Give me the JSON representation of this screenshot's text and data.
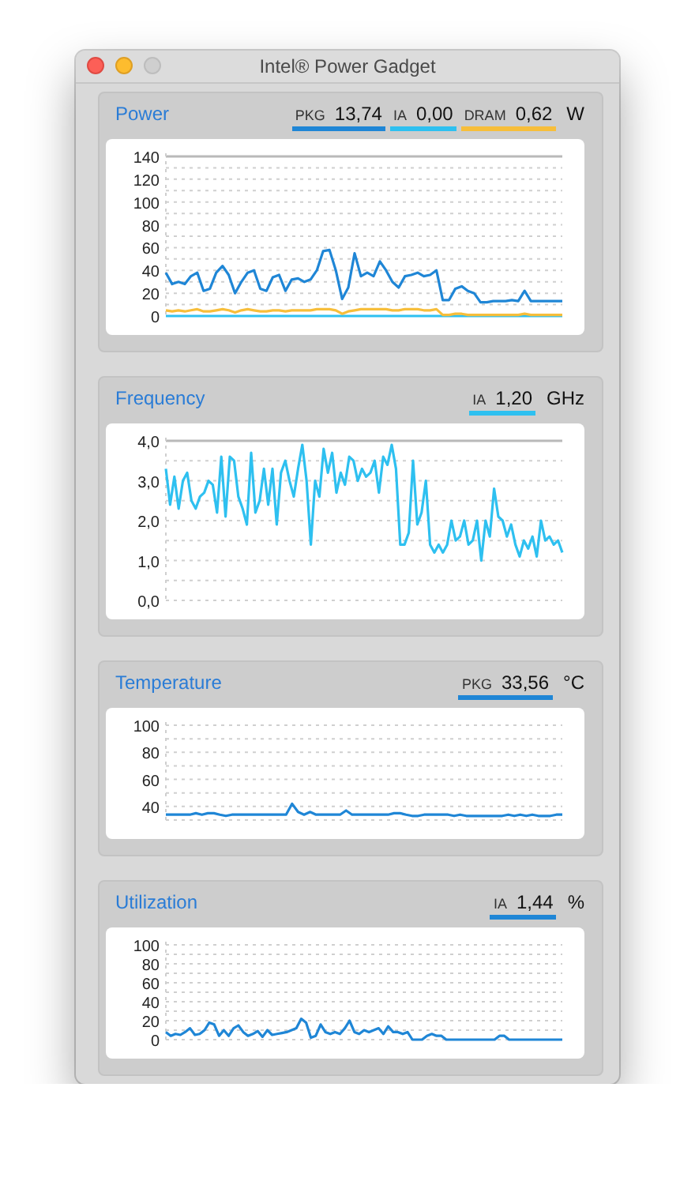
{
  "window": {
    "title": "Intel® Power Gadget"
  },
  "panels": [
    {
      "title": "Power",
      "readouts": [
        {
          "value": "13,74"
        },
        {
          "value": "0,00"
        },
        {
          "value": "0,62"
        }
      ],
      "unit": "W",
      "chart_data": {
        "type": "line",
        "grid": true,
        "ylim": [
          0,
          140
        ],
        "yticks": [
          0,
          20,
          40,
          60,
          80,
          100,
          120,
          140
        ],
        "series": [
          {
            "name": "PKG",
            "color": "#1f86d6",
            "values": [
              38,
              28,
              30,
              28,
              35,
              38,
              22,
              24,
              38,
              44,
              36,
              20,
              30,
              38,
              40,
              24,
              22,
              34,
              36,
              22,
              32,
              33,
              30,
              32,
              40,
              57,
              58,
              40,
              15,
              25,
              55,
              35,
              38,
              35,
              48,
              40,
              30,
              25,
              35,
              36,
              38,
              35,
              36,
              40,
              14,
              14,
              24,
              26,
              22,
              20,
              12,
              12,
              13,
              13,
              13,
              14,
              13,
              22,
              13,
              13,
              13,
              13,
              13,
              13
            ]
          },
          {
            "name": "IA",
            "color": "#2ec0f0",
            "values": [
              0,
              0,
              0,
              0,
              0,
              0,
              0,
              0,
              0,
              0,
              0,
              0,
              0,
              0,
              0,
              0,
              0,
              0,
              0,
              0,
              0,
              0,
              0,
              0,
              0,
              0,
              0,
              0,
              0,
              0,
              0,
              0,
              0,
              0,
              0,
              0,
              0,
              0,
              0,
              0,
              0,
              0,
              0,
              0,
              0,
              0,
              0,
              0,
              0,
              0,
              0,
              0,
              0,
              0,
              0,
              0,
              0,
              0,
              0,
              0,
              0,
              0,
              0,
              0
            ]
          },
          {
            "name": "DRAM",
            "color": "#f7be3a",
            "values": [
              5,
              4,
              5,
              4,
              5,
              6,
              4,
              4,
              5,
              6,
              5,
              3,
              5,
              6,
              5,
              4,
              4,
              5,
              5,
              4,
              5,
              5,
              5,
              5,
              6,
              6,
              6,
              5,
              2,
              4,
              5,
              6,
              6,
              6,
              6,
              6,
              5,
              5,
              6,
              6,
              6,
              5,
              5,
              6,
              1,
              1,
              2,
              2,
              1,
              1,
              1,
              1,
              1,
              1,
              1,
              1,
              1,
              2,
              1,
              1,
              1,
              1,
              1,
              1
            ]
          }
        ]
      }
    },
    {
      "title": "Frequency",
      "readouts": [
        {
          "value": "1,20"
        }
      ],
      "unit": "GHz",
      "chart_data": {
        "type": "line",
        "grid": true,
        "ylim": [
          0,
          4
        ],
        "yticks": [
          {
            "value": 0,
            "label": "0,0"
          },
          {
            "value": 1,
            "label": "1,0"
          },
          {
            "value": 2,
            "label": "2,0"
          },
          {
            "value": 3,
            "label": "3,0"
          },
          {
            "value": 4,
            "label": "4,0"
          }
        ],
        "series": [
          {
            "name": "IA",
            "color": "#2ec0f0",
            "values": [
              3.3,
              2.4,
              3.1,
              2.3,
              3.0,
              3.2,
              2.5,
              2.3,
              2.6,
              2.7,
              3.0,
              2.9,
              2.2,
              3.6,
              2.1,
              3.6,
              3.5,
              2.6,
              2.3,
              1.9,
              3.7,
              2.2,
              2.5,
              3.3,
              2.4,
              3.3,
              1.9,
              3.2,
              3.5,
              3.0,
              2.6,
              3.3,
              3.9,
              3.0,
              1.4,
              3.0,
              2.6,
              3.8,
              3.2,
              3.7,
              2.7,
              3.2,
              2.9,
              3.6,
              3.5,
              3.0,
              3.3,
              3.1,
              3.2,
              3.5,
              2.7,
              3.6,
              3.4,
              3.9,
              3.3,
              1.4,
              1.4,
              1.7,
              3.5,
              1.9,
              2.2,
              3.0,
              1.4,
              1.2,
              1.4,
              1.2,
              1.4,
              2.0,
              1.5,
              1.6,
              2.0,
              1.4,
              1.5,
              2.0,
              1.0,
              2.0,
              1.6,
              2.8,
              2.1,
              2.0,
              1.6,
              1.9,
              1.4,
              1.1,
              1.5,
              1.3,
              1.6,
              1.1,
              2.0,
              1.5,
              1.6,
              1.4,
              1.5,
              1.2
            ]
          }
        ]
      }
    },
    {
      "title": "Temperature",
      "readouts": [
        {
          "value": "33,56"
        }
      ],
      "unit": "°C",
      "chart_data": {
        "type": "line",
        "grid": true,
        "ylim": [
          30,
          100
        ],
        "yticks": [
          40,
          60,
          80,
          100
        ],
        "series": [
          {
            "name": "PKG",
            "color": "#1f86d6",
            "values": [
              34,
              34,
              34,
              34,
              34,
              35,
              34,
              35,
              35,
              34,
              33,
              34,
              34,
              34,
              34,
              34,
              34,
              34,
              34,
              34,
              34,
              42,
              36,
              34,
              36,
              34,
              34,
              34,
              34,
              34,
              37,
              34,
              34,
              34,
              34,
              34,
              34,
              34,
              35,
              35,
              34,
              33,
              33,
              34,
              34,
              34,
              34,
              34,
              33,
              34,
              33,
              33,
              33,
              33,
              33,
              33,
              33,
              34,
              33,
              34,
              33,
              34,
              33,
              33,
              33,
              34,
              34
            ]
          }
        ]
      }
    },
    {
      "title": "Utilization",
      "readouts": [
        {
          "value": "1,44"
        }
      ],
      "unit": "%",
      "chart_data": {
        "type": "line",
        "grid": true,
        "ylim": [
          0,
          100
        ],
        "yticks": [
          0,
          20,
          40,
          60,
          80,
          100
        ],
        "series": [
          {
            "name": "IA",
            "color": "#1f86d6",
            "values": [
              8,
              4,
              6,
              5,
              8,
              12,
              5,
              6,
              10,
              18,
              16,
              4,
              10,
              4,
              12,
              15,
              8,
              4,
              6,
              9,
              3,
              10,
              5,
              6,
              7,
              8,
              10,
              12,
              22,
              18,
              2,
              4,
              16,
              8,
              6,
              8,
              6,
              12,
              20,
              8,
              6,
              10,
              8,
              10,
              12,
              6,
              14,
              8,
              8,
              6,
              8,
              0,
              0,
              0,
              4,
              6,
              4,
              4,
              0,
              0,
              0,
              0,
              0,
              0,
              0,
              0,
              0,
              0,
              0,
              4,
              4,
              0,
              0,
              0,
              0,
              0,
              0,
              0,
              0,
              0,
              0,
              0,
              0
            ]
          }
        ]
      }
    }
  ]
}
